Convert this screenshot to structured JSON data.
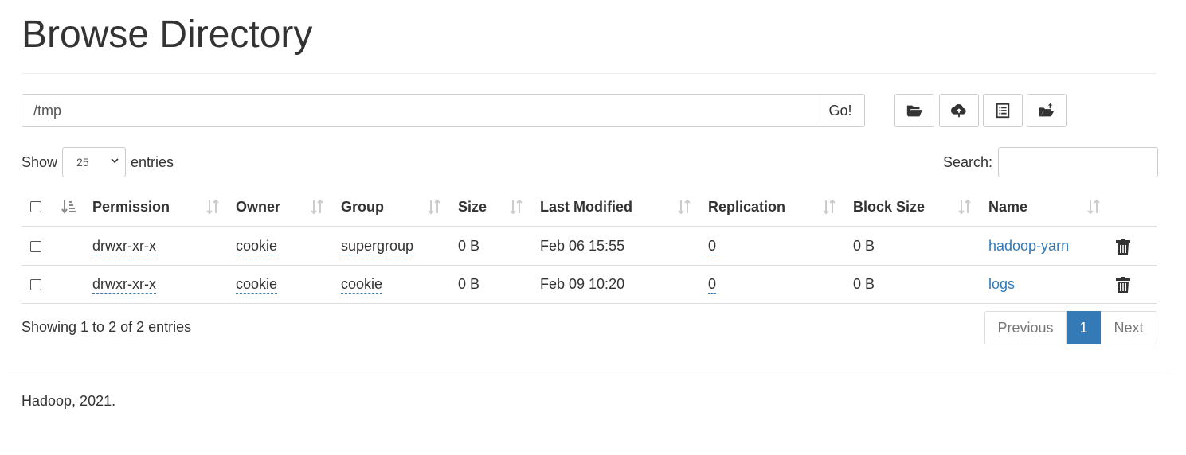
{
  "page": {
    "title": "Browse Directory"
  },
  "pathbar": {
    "value": "/tmp",
    "go_label": "Go!"
  },
  "toolbar": [
    {
      "name": "create-directory-button",
      "icon": "folder-open-icon"
    },
    {
      "name": "upload-button",
      "icon": "cloud-upload-icon"
    },
    {
      "name": "cut-paste-button",
      "icon": "list-icon"
    },
    {
      "name": "move-button",
      "icon": "folder-move-icon"
    }
  ],
  "length": {
    "show_label": "Show",
    "value": "25",
    "entries_label": "entries"
  },
  "search": {
    "label": "Search:",
    "value": ""
  },
  "table": {
    "columns": [
      "Permission",
      "Owner",
      "Group",
      "Size",
      "Last Modified",
      "Replication",
      "Block Size",
      "Name"
    ],
    "rows": [
      {
        "permission": "drwxr-xr-x",
        "owner": "cookie",
        "group": "supergroup",
        "size": "0 B",
        "modified": "Feb 06 15:55",
        "replication": "0",
        "block_size": "0 B",
        "name": "hadoop-yarn"
      },
      {
        "permission": "drwxr-xr-x",
        "owner": "cookie",
        "group": "cookie",
        "size": "0 B",
        "modified": "Feb 09 10:20",
        "replication": "0",
        "block_size": "0 B",
        "name": "logs"
      }
    ]
  },
  "info": "Showing 1 to 2 of 2 entries",
  "pagination": {
    "previous": "Previous",
    "current": "1",
    "next": "Next"
  },
  "footer": "Hadoop, 2021.",
  "colors": {
    "link": "#337ab7",
    "border": "#dddddd"
  }
}
